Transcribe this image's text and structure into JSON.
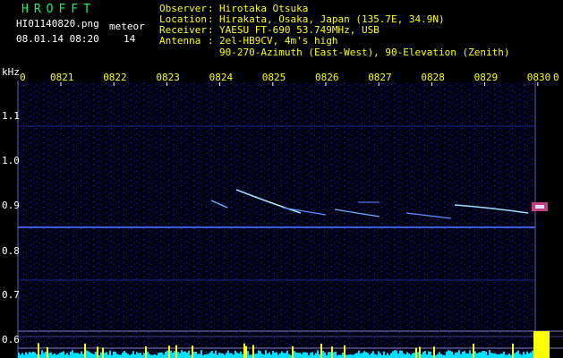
{
  "header": {
    "logo": "HROFFT",
    "filename": "HI01140820.png",
    "datetime": "08.01.14 08:20",
    "meteor_label": "meteor",
    "meteor_count": "14",
    "info": [
      {
        "key": "Observer",
        "sep": ":",
        "value": "Hirotaka Otsuka"
      },
      {
        "key": "Location",
        "sep": ":",
        "value": "Hirakata, Osaka, Japan (135.7E, 34.9N)"
      },
      {
        "key": "Receiver",
        "sep": ":",
        "value": "YAESU FT-690 53.749MHz, USB"
      },
      {
        "key": "Antenna",
        "sep": ":",
        "value": "2el-HB9CV, 4m's high"
      },
      {
        "key": "",
        "sep": "",
        "value": "90-270-Azimuth (East-West), 90-Elevation (Zenith)"
      }
    ]
  },
  "chart_data": {
    "type": "heatmap",
    "ylabel": "kHz",
    "x_ticks": [
      "0821",
      "0822",
      "0823",
      "0824",
      "0825",
      "0826",
      "0827",
      "0828",
      "0829",
      "0830"
    ],
    "x_edge_labels": [
      "0",
      "0"
    ],
    "y_ticks": [
      "1.1",
      "1.0",
      "0.9",
      "0.8",
      "0.7",
      "0.6"
    ],
    "y_range": [
      0.58,
      1.15
    ],
    "colors": {
      "background": "#000000",
      "noise": "#0a0a6a",
      "carrier": "#2040c0",
      "meteor": "#a0e0ff",
      "strong": "#ffff00",
      "text": "#ffff00"
    }
  }
}
